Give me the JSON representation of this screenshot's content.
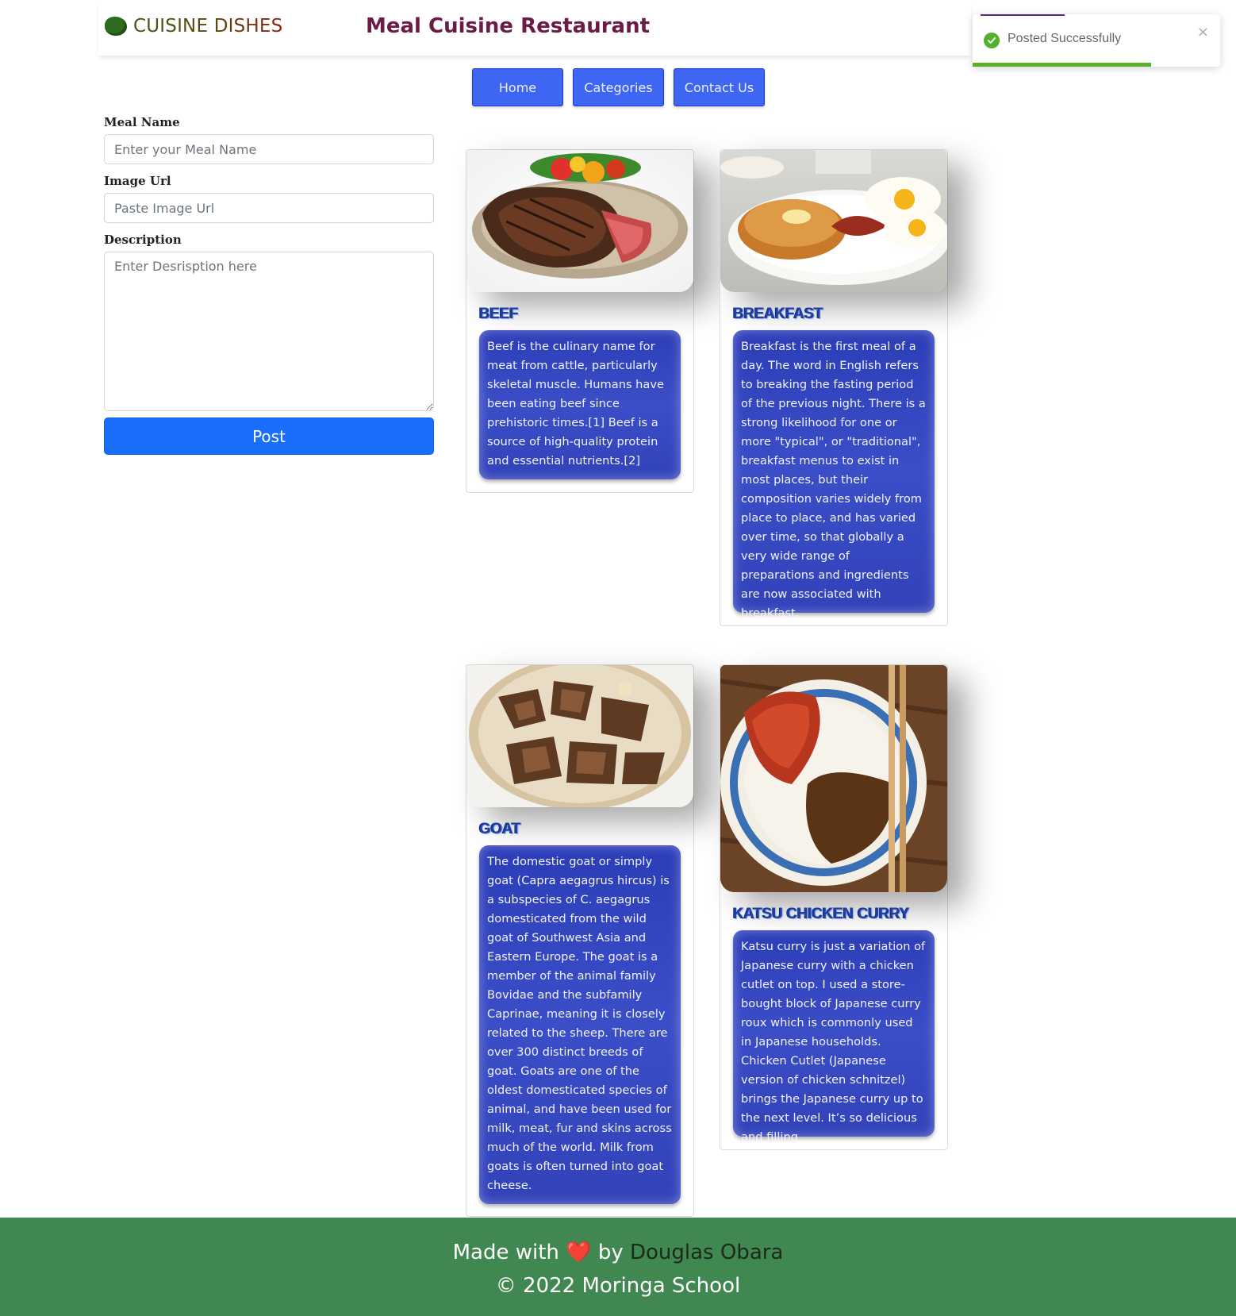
{
  "header": {
    "brand": "CUISINE DISHES",
    "title": "Meal Cuisine Restaurant"
  },
  "nav": {
    "home": "Home",
    "categories": "Categories",
    "contact": "Contact Us"
  },
  "toast": {
    "message": "Posted Successfully",
    "close": "×",
    "progress": 0.72,
    "colors": {
      "success": "#52b02a"
    }
  },
  "form": {
    "meal_name_label": "Meal Name",
    "meal_name_placeholder": "Enter your Meal Name",
    "image_url_label": "Image Url",
    "image_url_placeholder": "Paste Image Url",
    "description_label": "Description",
    "description_placeholder": "Enter Desrisption here",
    "post_label": "Post"
  },
  "cards": [
    {
      "title": "BEEF",
      "description": "Beef is the culinary name for meat from cattle, particularly skeletal muscle. Humans have been eating beef since prehistoric times.[1] Beef is a source of high-quality protein and essential nutrients.[2]"
    },
    {
      "title": "BREAKFAST",
      "description": "Breakfast is the first meal of a day. The word in English refers to breaking the fasting period of the previous night. There is a strong likelihood for one or more \"typical\", or \"traditional\", breakfast menus to exist in most places, but their composition varies widely from place to place, and has varied over time, so that globally a very wide range of preparations and ingredients are now associated with breakfast."
    },
    {
      "title": "GOAT",
      "description": "The domestic goat or simply goat (Capra aegagrus hircus) is a subspecies of C. aegagrus domesticated from the wild goat of Southwest Asia and Eastern Europe. The goat is a member of the animal family Bovidae and the subfamily Caprinae, meaning it is closely related to the sheep. There are over 300 distinct breeds of goat. Goats are one of the oldest domesticated species of animal, and have been used for milk, meat, fur and skins across much of the world. Milk from goats is often turned into goat cheese."
    },
    {
      "title": "KATSU CHICKEN CURRY",
      "description": "Katsu curry is just a variation of Japanese curry with a chicken cutlet on top. I used a store-bought block of Japanese curry roux which is commonly used in Japanese households. Chicken Cutlet (Japanese version of chicken schnitzel) brings the Japanese curry up to the next level. It’s so delicious and filling."
    }
  ],
  "footer": {
    "made_with": "Made with",
    "heart": "❤️",
    "by": "by",
    "author": "Douglas Obara",
    "copyright": "© 2022 Moringa School"
  }
}
